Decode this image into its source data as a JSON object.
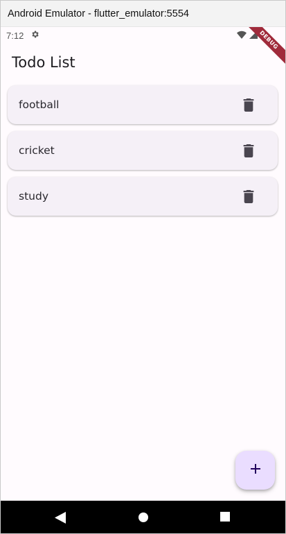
{
  "window": {
    "title": "Android Emulator - flutter_emulator:5554"
  },
  "status_bar": {
    "time": "7:12",
    "icons": [
      "settings-icon",
      "wifi-icon",
      "signal-icon",
      "battery-icon"
    ]
  },
  "debug_banner": {
    "label": "DEBUG"
  },
  "app_bar": {
    "title": "Todo List"
  },
  "todos": [
    {
      "label": "football",
      "action_icon": "trash-icon"
    },
    {
      "label": "cricket",
      "action_icon": "trash-icon"
    },
    {
      "label": "study",
      "action_icon": "trash-icon"
    }
  ],
  "fab": {
    "icon": "plus-icon"
  },
  "nav_bar": {
    "buttons": [
      "back-icon",
      "home-icon",
      "recents-icon"
    ]
  },
  "colors": {
    "background": "#fffbfe",
    "card": "#f5f0f7",
    "fab": "#eaddff",
    "debug": "#a02b3b"
  }
}
